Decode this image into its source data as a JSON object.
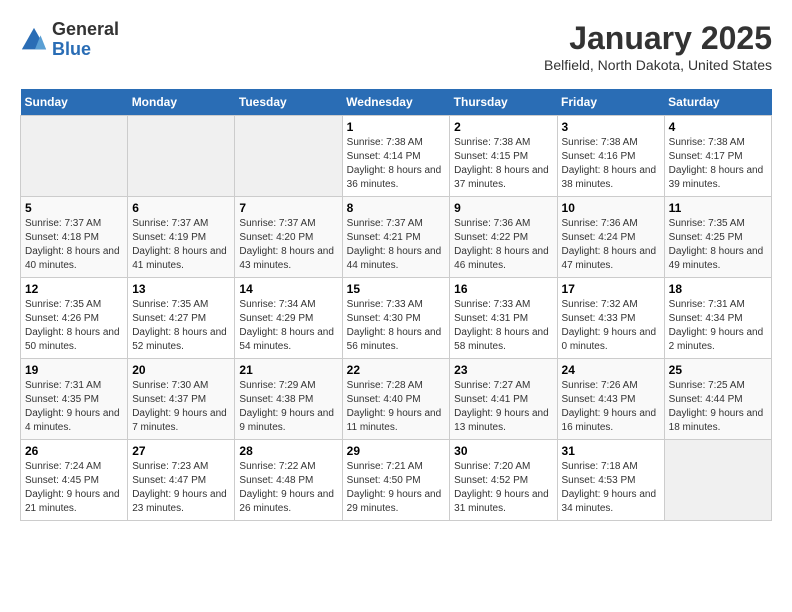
{
  "header": {
    "logo_general": "General",
    "logo_blue": "Blue",
    "month_title": "January 2025",
    "location": "Belfield, North Dakota, United States"
  },
  "days_of_week": [
    "Sunday",
    "Monday",
    "Tuesday",
    "Wednesday",
    "Thursday",
    "Friday",
    "Saturday"
  ],
  "weeks": [
    [
      {
        "day": "",
        "sunrise": "",
        "sunset": "",
        "daylight": ""
      },
      {
        "day": "",
        "sunrise": "",
        "sunset": "",
        "daylight": ""
      },
      {
        "day": "",
        "sunrise": "",
        "sunset": "",
        "daylight": ""
      },
      {
        "day": "1",
        "sunrise": "Sunrise: 7:38 AM",
        "sunset": "Sunset: 4:14 PM",
        "daylight": "Daylight: 8 hours and 36 minutes."
      },
      {
        "day": "2",
        "sunrise": "Sunrise: 7:38 AM",
        "sunset": "Sunset: 4:15 PM",
        "daylight": "Daylight: 8 hours and 37 minutes."
      },
      {
        "day": "3",
        "sunrise": "Sunrise: 7:38 AM",
        "sunset": "Sunset: 4:16 PM",
        "daylight": "Daylight: 8 hours and 38 minutes."
      },
      {
        "day": "4",
        "sunrise": "Sunrise: 7:38 AM",
        "sunset": "Sunset: 4:17 PM",
        "daylight": "Daylight: 8 hours and 39 minutes."
      }
    ],
    [
      {
        "day": "5",
        "sunrise": "Sunrise: 7:37 AM",
        "sunset": "Sunset: 4:18 PM",
        "daylight": "Daylight: 8 hours and 40 minutes."
      },
      {
        "day": "6",
        "sunrise": "Sunrise: 7:37 AM",
        "sunset": "Sunset: 4:19 PM",
        "daylight": "Daylight: 8 hours and 41 minutes."
      },
      {
        "day": "7",
        "sunrise": "Sunrise: 7:37 AM",
        "sunset": "Sunset: 4:20 PM",
        "daylight": "Daylight: 8 hours and 43 minutes."
      },
      {
        "day": "8",
        "sunrise": "Sunrise: 7:37 AM",
        "sunset": "Sunset: 4:21 PM",
        "daylight": "Daylight: 8 hours and 44 minutes."
      },
      {
        "day": "9",
        "sunrise": "Sunrise: 7:36 AM",
        "sunset": "Sunset: 4:22 PM",
        "daylight": "Daylight: 8 hours and 46 minutes."
      },
      {
        "day": "10",
        "sunrise": "Sunrise: 7:36 AM",
        "sunset": "Sunset: 4:24 PM",
        "daylight": "Daylight: 8 hours and 47 minutes."
      },
      {
        "day": "11",
        "sunrise": "Sunrise: 7:35 AM",
        "sunset": "Sunset: 4:25 PM",
        "daylight": "Daylight: 8 hours and 49 minutes."
      }
    ],
    [
      {
        "day": "12",
        "sunrise": "Sunrise: 7:35 AM",
        "sunset": "Sunset: 4:26 PM",
        "daylight": "Daylight: 8 hours and 50 minutes."
      },
      {
        "day": "13",
        "sunrise": "Sunrise: 7:35 AM",
        "sunset": "Sunset: 4:27 PM",
        "daylight": "Daylight: 8 hours and 52 minutes."
      },
      {
        "day": "14",
        "sunrise": "Sunrise: 7:34 AM",
        "sunset": "Sunset: 4:29 PM",
        "daylight": "Daylight: 8 hours and 54 minutes."
      },
      {
        "day": "15",
        "sunrise": "Sunrise: 7:33 AM",
        "sunset": "Sunset: 4:30 PM",
        "daylight": "Daylight: 8 hours and 56 minutes."
      },
      {
        "day": "16",
        "sunrise": "Sunrise: 7:33 AM",
        "sunset": "Sunset: 4:31 PM",
        "daylight": "Daylight: 8 hours and 58 minutes."
      },
      {
        "day": "17",
        "sunrise": "Sunrise: 7:32 AM",
        "sunset": "Sunset: 4:33 PM",
        "daylight": "Daylight: 9 hours and 0 minutes."
      },
      {
        "day": "18",
        "sunrise": "Sunrise: 7:31 AM",
        "sunset": "Sunset: 4:34 PM",
        "daylight": "Daylight: 9 hours and 2 minutes."
      }
    ],
    [
      {
        "day": "19",
        "sunrise": "Sunrise: 7:31 AM",
        "sunset": "Sunset: 4:35 PM",
        "daylight": "Daylight: 9 hours and 4 minutes."
      },
      {
        "day": "20",
        "sunrise": "Sunrise: 7:30 AM",
        "sunset": "Sunset: 4:37 PM",
        "daylight": "Daylight: 9 hours and 7 minutes."
      },
      {
        "day": "21",
        "sunrise": "Sunrise: 7:29 AM",
        "sunset": "Sunset: 4:38 PM",
        "daylight": "Daylight: 9 hours and 9 minutes."
      },
      {
        "day": "22",
        "sunrise": "Sunrise: 7:28 AM",
        "sunset": "Sunset: 4:40 PM",
        "daylight": "Daylight: 9 hours and 11 minutes."
      },
      {
        "day": "23",
        "sunrise": "Sunrise: 7:27 AM",
        "sunset": "Sunset: 4:41 PM",
        "daylight": "Daylight: 9 hours and 13 minutes."
      },
      {
        "day": "24",
        "sunrise": "Sunrise: 7:26 AM",
        "sunset": "Sunset: 4:43 PM",
        "daylight": "Daylight: 9 hours and 16 minutes."
      },
      {
        "day": "25",
        "sunrise": "Sunrise: 7:25 AM",
        "sunset": "Sunset: 4:44 PM",
        "daylight": "Daylight: 9 hours and 18 minutes."
      }
    ],
    [
      {
        "day": "26",
        "sunrise": "Sunrise: 7:24 AM",
        "sunset": "Sunset: 4:45 PM",
        "daylight": "Daylight: 9 hours and 21 minutes."
      },
      {
        "day": "27",
        "sunrise": "Sunrise: 7:23 AM",
        "sunset": "Sunset: 4:47 PM",
        "daylight": "Daylight: 9 hours and 23 minutes."
      },
      {
        "day": "28",
        "sunrise": "Sunrise: 7:22 AM",
        "sunset": "Sunset: 4:48 PM",
        "daylight": "Daylight: 9 hours and 26 minutes."
      },
      {
        "day": "29",
        "sunrise": "Sunrise: 7:21 AM",
        "sunset": "Sunset: 4:50 PM",
        "daylight": "Daylight: 9 hours and 29 minutes."
      },
      {
        "day": "30",
        "sunrise": "Sunrise: 7:20 AM",
        "sunset": "Sunset: 4:52 PM",
        "daylight": "Daylight: 9 hours and 31 minutes."
      },
      {
        "day": "31",
        "sunrise": "Sunrise: 7:18 AM",
        "sunset": "Sunset: 4:53 PM",
        "daylight": "Daylight: 9 hours and 34 minutes."
      },
      {
        "day": "",
        "sunrise": "",
        "sunset": "",
        "daylight": ""
      }
    ]
  ]
}
